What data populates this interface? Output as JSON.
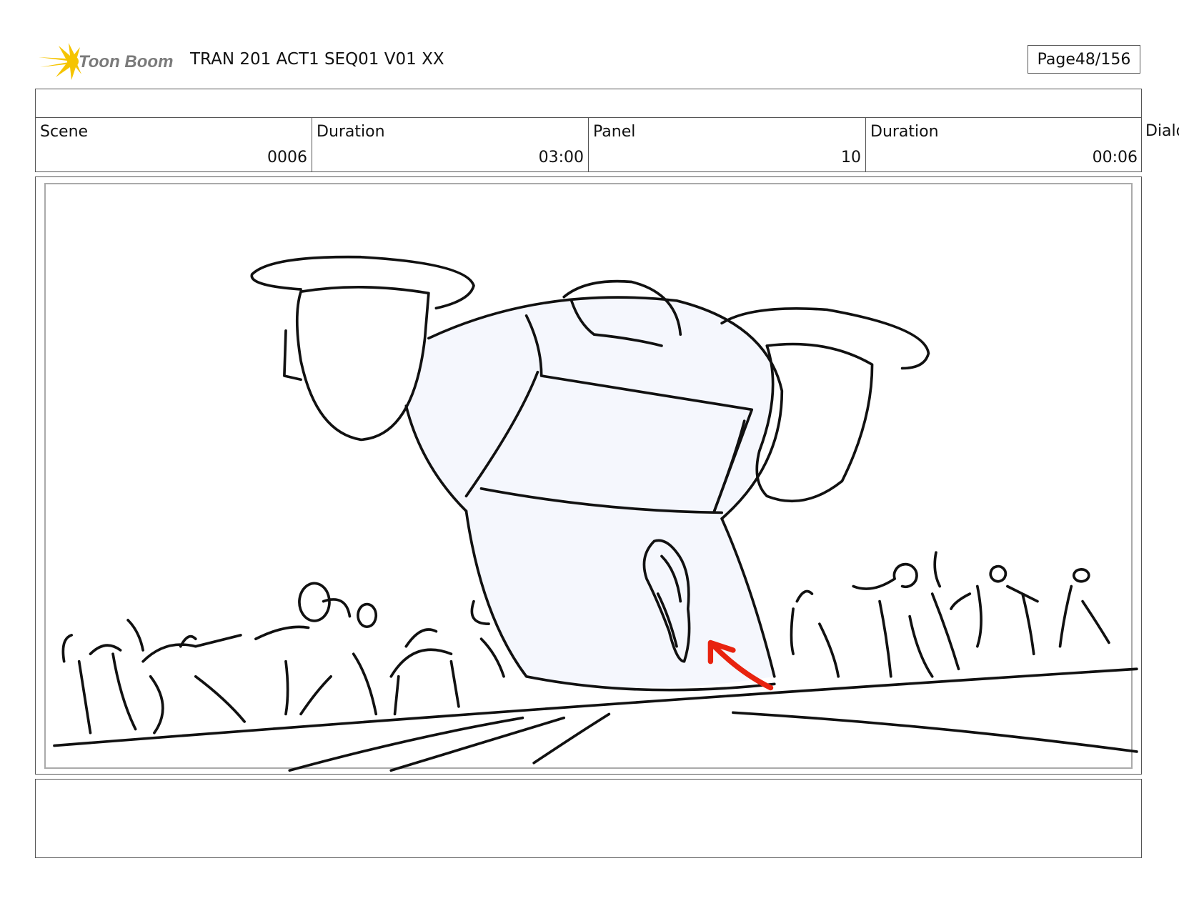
{
  "header": {
    "logo_text": "Toon Boom",
    "title": "TRAN 201 ACT1 SEQ01 V01 XX",
    "page_label": "Page",
    "page_value": "48/156"
  },
  "info": {
    "scene_label": "Scene",
    "scene_value": "0006",
    "scene_duration_label": "Duration",
    "scene_duration_value": "03:00",
    "panel_label": "Panel",
    "panel_value": "10",
    "panel_duration_label": "Duration",
    "panel_duration_value": "00:06",
    "dialog_label": "Dialo"
  },
  "colors": {
    "logo_star": "#f5c400",
    "arrow": "#e8230f",
    "fill": "#f5f7fd"
  },
  "panel_image": "storyboard sketch"
}
